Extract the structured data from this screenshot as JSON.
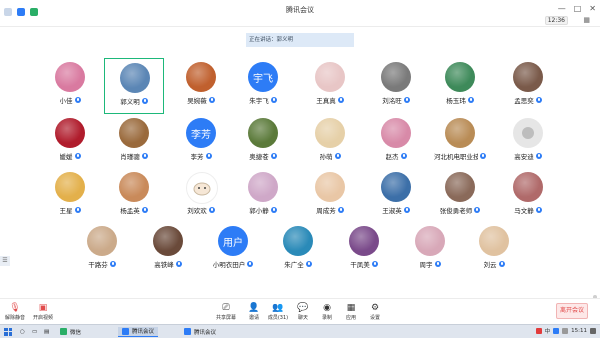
{
  "window": {
    "title": "腾讯会议",
    "clock": "12:36",
    "controls": [
      "—",
      "□",
      "✕"
    ]
  },
  "speaking_banner": "正在讲话：郭义明",
  "participants": [
    {
      "name": "小佳",
      "avatar": "photo",
      "color": "#d97aa0"
    },
    {
      "name": "郭义明",
      "avatar": "photo",
      "color": "#5b86b5",
      "active": true
    },
    {
      "name": "吴婉薇",
      "avatar": "photo",
      "color": "#c0602e"
    },
    {
      "name": "朱宇飞",
      "avatar": "blue",
      "initials": "宇飞"
    },
    {
      "name": "王真真",
      "avatar": "photo",
      "color": "#e8c6c6"
    },
    {
      "name": "刘洺旺",
      "avatar": "photo",
      "color": "#7a7a7a"
    },
    {
      "name": "杨玉玮",
      "avatar": "photo",
      "color": "#3e8a5a"
    },
    {
      "name": "孟思奕",
      "avatar": "photo",
      "color": "#7a5a4a"
    },
    {
      "name": "媛媛",
      "avatar": "photo",
      "color": "#b01c2c"
    },
    {
      "name": "肖瑾骢",
      "avatar": "photo",
      "color": "#9a6a3c"
    },
    {
      "name": "李芳",
      "avatar": "blue",
      "initials": "李芳"
    },
    {
      "name": "奥捷苍",
      "avatar": "photo",
      "color": "#5b7a3a"
    },
    {
      "name": "孙萌",
      "avatar": "photo",
      "color": "#e6d0a8"
    },
    {
      "name": "赵杰",
      "avatar": "photo",
      "color": "#d88aa8"
    },
    {
      "name": "河北机电职业技...",
      "avatar": "photo",
      "color": "#b98c56"
    },
    {
      "name": "高安迪",
      "avatar": "gray"
    },
    {
      "name": "王星",
      "avatar": "photo",
      "color": "#e3b04b"
    },
    {
      "name": "杨孟英",
      "avatar": "photo",
      "color": "#c98a5a"
    },
    {
      "name": "刘欢欢",
      "avatar": "white"
    },
    {
      "name": "郭小静",
      "avatar": "photo",
      "color": "#cfa8c8"
    },
    {
      "name": "周成芳",
      "avatar": "photo",
      "color": "#e9c7a6"
    },
    {
      "name": "王淑英",
      "avatar": "photo",
      "color": "#3c6fa8"
    },
    {
      "name": "张俊勇老师",
      "avatar": "photo",
      "color": "#8a6a5a"
    },
    {
      "name": "马文静",
      "avatar": "photo",
      "color": "#b06a6a"
    },
    {
      "name": "干路芬",
      "avatar": "photo",
      "color": "#cbaa8a"
    },
    {
      "name": "高铁峰",
      "avatar": "photo",
      "color": "#6a4a3a"
    },
    {
      "name": "小明衣田户",
      "avatar": "blue",
      "initials": "用户"
    },
    {
      "name": "朱广全",
      "avatar": "photo",
      "color": "#2a8ab8"
    },
    {
      "name": "干凤美",
      "avatar": "photo",
      "color": "#7a4a8a"
    },
    {
      "name": "周宇",
      "avatar": "photo",
      "color": "#d8a8b8"
    },
    {
      "name": "刘云",
      "avatar": "photo",
      "color": "#e0c2a0"
    }
  ],
  "toolbar": {
    "left": [
      {
        "label": "解除静音",
        "icon": "mic-off-icon"
      },
      {
        "label": "开启视频",
        "icon": "video-off-icon"
      }
    ],
    "center": [
      {
        "label": "共享屏幕",
        "icon": "share-screen-icon"
      },
      {
        "label": "邀请",
        "icon": "invite-icon"
      },
      {
        "label": "成员(31)",
        "icon": "members-icon"
      },
      {
        "label": "聊天",
        "icon": "chat-icon"
      },
      {
        "label": "录制",
        "icon": "record-icon"
      },
      {
        "label": "应用",
        "icon": "apps-icon"
      },
      {
        "label": "设置",
        "icon": "settings-icon"
      }
    ],
    "end_meeting": "离开会议"
  },
  "taskbar": {
    "items": [
      {
        "label": "微信",
        "color": "#2aae67"
      },
      {
        "label": "腾讯会议",
        "color": "#2d7cf6",
        "active": true
      },
      {
        "label": "腾讯会议",
        "color": "#2d7cf6"
      }
    ],
    "tray_text": "中",
    "time": "15:11",
    "colors": {
      "tray_red": "#e23b3b",
      "tray_blue": "#2d7cf6"
    }
  }
}
